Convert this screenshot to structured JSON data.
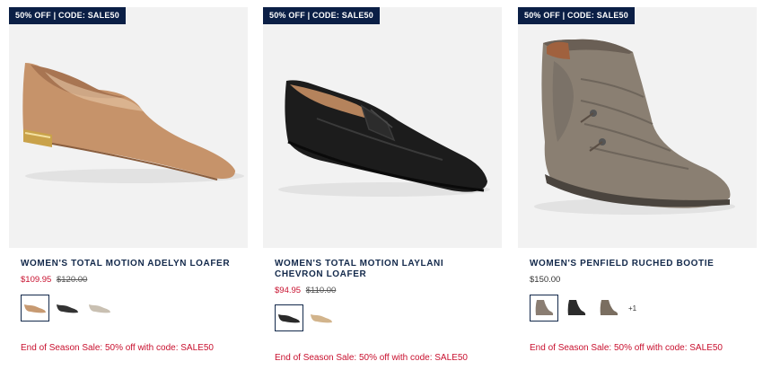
{
  "products": [
    {
      "badge": "50% OFF | CODE: SALE50",
      "title": "WOMEN'S TOTAL MOTION ADELYN LOAFER",
      "sale_price": "$109.95",
      "original_price": "$120.00",
      "swatch_colors": [
        "#c79a72",
        "#333333",
        "#c9c0b2"
      ],
      "selected_swatch": 0,
      "more_colors": "",
      "promo": "End of Season Sale: 50% off with code: SALE50"
    },
    {
      "badge": "50% OFF | CODE: SALE50",
      "title": "WOMEN'S TOTAL MOTION LAYLANI CHEVRON LOAFER",
      "sale_price": "$94.95",
      "original_price": "$110.00",
      "swatch_colors": [
        "#2a2a2a",
        "#d2b48c"
      ],
      "selected_swatch": 0,
      "more_colors": "",
      "promo": "End of Season Sale: 50% off with code: SALE50"
    },
    {
      "badge": "50% OFF | CODE: SALE50",
      "title": "WOMEN'S PENFIELD RUCHED BOOTIE",
      "price": "$150.00",
      "swatch_colors": [
        "#8a7d72",
        "#2b2b2b",
        "#7a6e60"
      ],
      "selected_swatch": 0,
      "more_colors": "+1",
      "promo": "End of Season Sale: 50% off with code: SALE50"
    }
  ],
  "colors": {
    "badge_bg": "#0b1f46",
    "title": "#13294b",
    "sale": "#c8102e"
  }
}
